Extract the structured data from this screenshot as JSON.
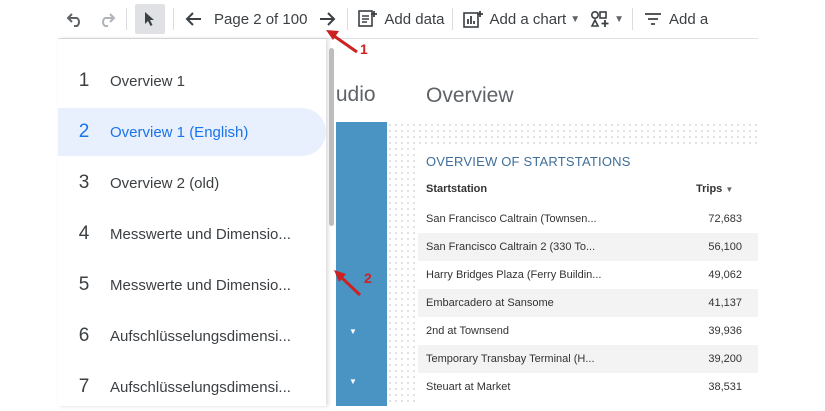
{
  "toolbar": {
    "undo_icon": "undo-icon",
    "redo_icon": "redo-icon",
    "select_icon": "cursor-arrow-icon",
    "page_indicator": "Page 2 of 100",
    "add_data": "Add data",
    "add_chart": "Add a chart",
    "add_filter_partial": "Add a"
  },
  "pages": [
    {
      "num": "1",
      "label": "Overview 1"
    },
    {
      "num": "2",
      "label": "Overview 1 (English)",
      "active": true
    },
    {
      "num": "3",
      "label": "Overview 2 (old)"
    },
    {
      "num": "4",
      "label": "Messwerte und Dimensio..."
    },
    {
      "num": "5",
      "label": "Messwerte und Dimensio..."
    },
    {
      "num": "6",
      "label": "Aufschlüsselungsdimensi..."
    },
    {
      "num": "7",
      "label": "Aufschlüsselungsdimensi..."
    }
  ],
  "canvas": {
    "brand_partial": "tudio",
    "title": "Overview",
    "table": {
      "title": "OVERVIEW OF STARTSTATIONS",
      "col_station": "Startstation",
      "col_trips": "Trips",
      "rows": [
        {
          "station": "San Francisco Caltrain (Townsen...",
          "trips": "72,683"
        },
        {
          "station": "San Francisco Caltrain 2 (330 To...",
          "trips": "56,100"
        },
        {
          "station": "Harry Bridges Plaza (Ferry Buildin...",
          "trips": "49,062"
        },
        {
          "station": "Embarcadero at Sansome",
          "trips": "41,137"
        },
        {
          "station": "2nd at Townsend",
          "trips": "39,936"
        },
        {
          "station": "Temporary Transbay Terminal (H...",
          "trips": "39,200"
        },
        {
          "station": "Steuart at Market",
          "trips": "38,531"
        }
      ]
    }
  },
  "annotations": {
    "a1": "1",
    "a2": "2"
  },
  "colors": {
    "accent": "#1a73e8",
    "sidebar_bar": "#4a94c4",
    "arrow": "#cc2222"
  }
}
